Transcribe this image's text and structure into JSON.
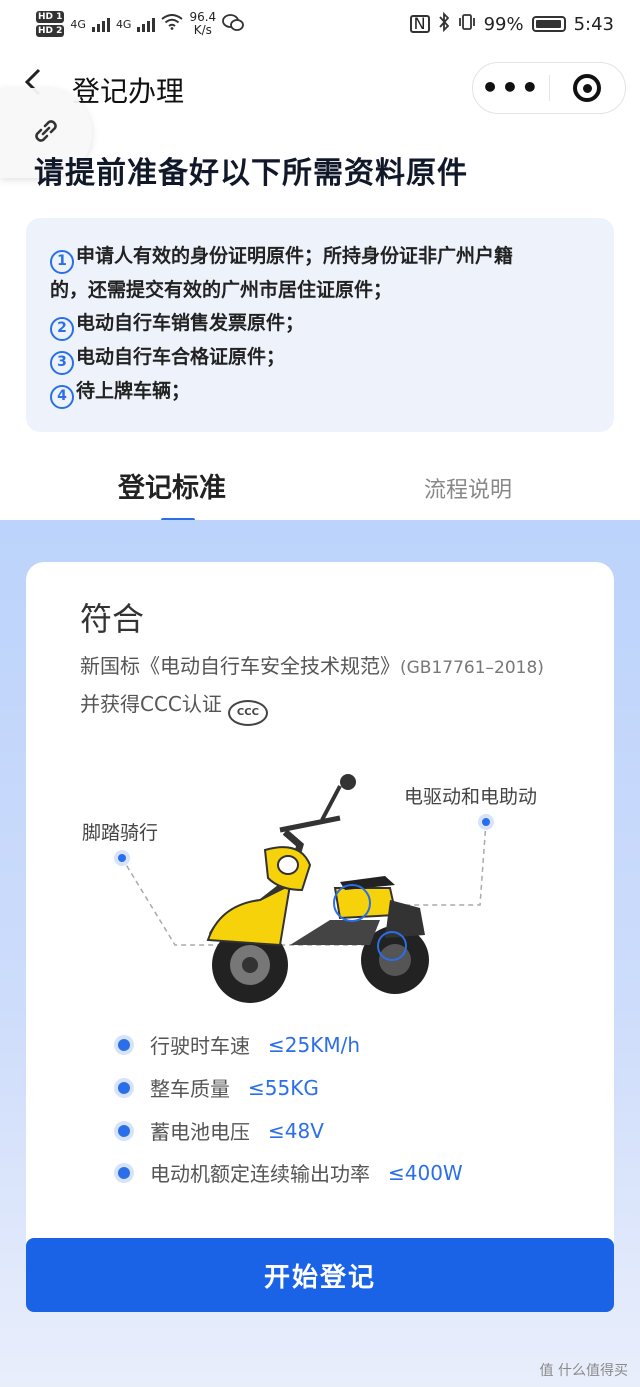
{
  "status_bar": {
    "sim1": "HD 1",
    "sim2": "HD 2",
    "net1": "4G",
    "net2": "4G",
    "speed_value": "96.4",
    "speed_unit": "K/s",
    "battery": "99%",
    "time": "5:43"
  },
  "nav": {
    "title": "登记办理",
    "more_icon": "more-dots-icon",
    "close_icon": "target-icon"
  },
  "heading": "请提前准备好以下所需资料原件",
  "requirements": [
    {
      "num": "1",
      "text": "申请人有效的身份证明原件；所持身份证非广州户籍"
    },
    {
      "num": "",
      "text": "的，还需提交有效的广州市居住证原件；"
    },
    {
      "num": "2",
      "text": "电动自行车销售发票原件；"
    },
    {
      "num": "3",
      "text": "电动自行车合格证原件；"
    },
    {
      "num": "4",
      "text": "待上牌车辆；"
    }
  ],
  "tabs": {
    "active": "登记标准",
    "inactive": "流程说明"
  },
  "standard": {
    "title": "符合",
    "line1": "新国标《电动自行车安全技术规范》",
    "line1_code": "(GB17761–2018)",
    "line2": "并获得CCC认证",
    "ccc_mark": "CCC",
    "feature_left": "脚踏骑行",
    "feature_right": "电驱动和电助动",
    "specs": [
      {
        "label": "行驶时车速",
        "value": "≤25KM/h"
      },
      {
        "label": "整车质量",
        "value": "≤55KG"
      },
      {
        "label": "蓄电池电压",
        "value": "≤48V"
      },
      {
        "label": "电动机额定连续输出功率",
        "value": "≤400W"
      }
    ]
  },
  "button": "开始登记",
  "watermark": "值 什么值得买",
  "colors": {
    "accent": "#1a63e6",
    "scooter_yellow": "#f5d20a"
  }
}
